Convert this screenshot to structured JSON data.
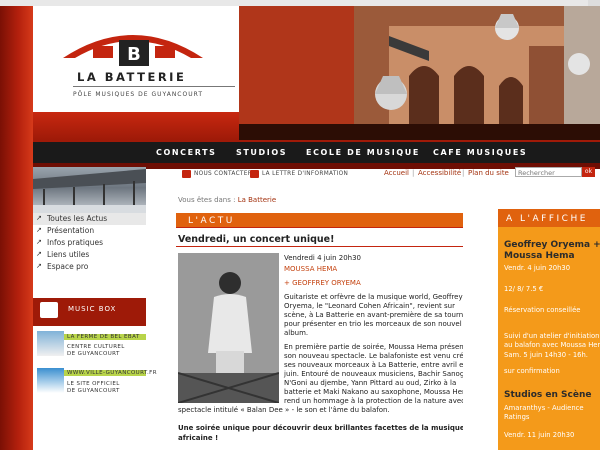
{
  "site": {
    "logo_name": "LA BATTERIE",
    "logo_tagline": "PÔLE MUSIQUES DE GUYANCOURT"
  },
  "nav": {
    "items": [
      "CONCERTS",
      "STUDIOS",
      "ECOLE DE MUSIQUE",
      "CAFE MUSIQUES"
    ]
  },
  "utility": {
    "contact": "nous contacter",
    "newsletter": "la lettre d'information",
    "home": "Accueil",
    "accessibility": "Accessibilité",
    "sitemap": "Plan du site",
    "search_placeholder": "Rechercher",
    "search_button": "ok"
  },
  "breadcrumb": {
    "prefix": "Vous êtes dans :",
    "current": "La Batterie"
  },
  "sidebar": {
    "items": [
      {
        "label": "Toutes les Actus"
      },
      {
        "label": "Présentation"
      },
      {
        "label": "Infos pratiques"
      },
      {
        "label": "Liens utiles"
      },
      {
        "label": "Espace pro"
      }
    ],
    "music_box": "MUSIC BOX",
    "partners": [
      {
        "label": "LA FERME DE BEL EBAT"
      },
      {
        "label": "CENTRE CULTUREL"
      },
      {
        "label": "DE GUYANCOURT"
      },
      {
        "label": "WWW.VILLE-GUYANCOURT.FR"
      },
      {
        "label": "LE SITE OFFICIEL"
      },
      {
        "label": "DE GUYANCOURT"
      }
    ]
  },
  "main": {
    "section_title": "L'ACTU",
    "article_title": "Vendredi, un concert unique!",
    "event_date": "Vendredi 4 juin 20h30",
    "artist_1": "MOUSSA HEMA",
    "artist_2": "+ GEOFFREY ORYEMA",
    "body_lines": [
      "Guitariste et orfèvre de la musique world, Geoffrey",
      "Oryema, le \"Leonard Cohen Africain\", revient sur",
      "scène, à La Batterie en avant-première de sa tournée,",
      "pour présenter en trio les morceaux de son nouvel",
      "album.",
      "",
      "En première partie de soirée, Moussa Hema présentera",
      "son nouveau spectacle. Le balafoniste est venu créer",
      "ses nouveaux morceaux à La Batterie, entre avril et",
      "juin. Entouré de nouveaux musiciens, Bachir Sanogo",
      "N'Goni au djembe, Yann Pittard au oud, Zirko à la",
      "batterie et Maki Nakano au saxophone, Moussa Hema",
      "rend un hommage à la protection de la nature avec ce",
      "spectacle intitulé « Balan Dee » - le son et l'âme du balafon."
    ],
    "closing_lines": [
      "Une soirée unique pour découvrir deux brillantes facettes de la musique",
      "africaine !"
    ]
  },
  "affiche": {
    "title": "A L'AFFICHE",
    "event1_title_1": "Geoffrey Oryema +",
    "event1_title_2": "Moussa Hema",
    "event1_date": "Vendr. 4 juin 20h30",
    "event1_price": "12/ 8/ 7.5 €",
    "event1_booking": "Réservation conseillée",
    "event1_desc_1": "Suivi d'un atelier d'initiation",
    "event1_desc_2": "au balafon avec Moussa Hema",
    "event1_desc_3": "Sam. 5 juin 14h30 - 16h.",
    "event1_confirm": "sur confirmation",
    "event2_title": "Studios en Scène",
    "event2_desc_1": "Amaranthys  -  Audience",
    "event2_desc_2": "Ratings",
    "event2_date": "Vendr. 11 juin 20h30"
  },
  "colors": {
    "brand_red": "#c4250f",
    "orange": "#e0620e",
    "affiche_bg": "#f49a1a",
    "nav_bg": "#1a1a1a"
  }
}
